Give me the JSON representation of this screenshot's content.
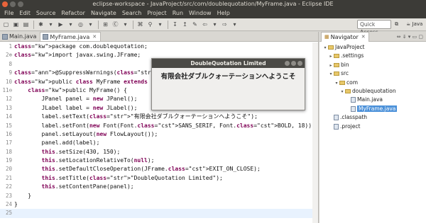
{
  "window": {
    "title": "eclipse-workspace - JavaProject/src/com/doublequotation/MyFrame.java - Eclipse IDE"
  },
  "menu": [
    "File",
    "Edit",
    "Source",
    "Refactor",
    "Navigate",
    "Search",
    "Project",
    "Run",
    "Window",
    "Help"
  ],
  "toolbar": {
    "quick_access": "Quick Access",
    "perspective_label": "Java"
  },
  "editor": {
    "tabs": [
      {
        "label": "Main.java",
        "active": false
      },
      {
        "label": "MyFrame.java",
        "active": true
      }
    ],
    "lines": [
      {
        "n": "1",
        "text": "package com.doublequotation;"
      },
      {
        "n": "2⊕",
        "text": "import javax.swing.JFrame;"
      },
      {
        "n": "8",
        "text": ""
      },
      {
        "n": "9",
        "text": "@SuppressWarnings(\"serial\")"
      },
      {
        "n": "10",
        "text": "public class MyFrame extends JFrame {"
      },
      {
        "n": "11⊖",
        "text": "    public MyFrame() {"
      },
      {
        "n": "12",
        "text": "        JPanel panel = new JPanel();"
      },
      {
        "n": "13",
        "text": "        JLabel label = new JLabel();"
      },
      {
        "n": "14",
        "text": "        label.setText(\"有限会社ダブルクォーテーションへようこそ\");"
      },
      {
        "n": "15",
        "text": "        label.setFont(new Font(Font.SANS_SERIF, Font.BOLD, 18));"
      },
      {
        "n": "16",
        "text": "        panel.setLayout(new FlowLayout());"
      },
      {
        "n": "17",
        "text": "        panel.add(label);"
      },
      {
        "n": "18",
        "text": "        this.setSize(430, 150);"
      },
      {
        "n": "19",
        "text": "        this.setLocationRelativeTo(null);"
      },
      {
        "n": "20",
        "text": "        this.setDefaultCloseOperation(JFrame.EXIT_ON_CLOSE);"
      },
      {
        "n": "21",
        "text": "        this.setTitle(\"DoubleQuotation Limited\");"
      },
      {
        "n": "22",
        "text": "        this.setContentPane(panel);"
      },
      {
        "n": "23",
        "text": "    }"
      },
      {
        "n": "24",
        "text": "}"
      },
      {
        "n": "25",
        "text": ""
      }
    ]
  },
  "navigator": {
    "tab_label": "Navigator",
    "tree": [
      {
        "label": "JavaProject",
        "depth": 0,
        "arrow": "▾",
        "kind": "folder"
      },
      {
        "label": ".settings",
        "depth": 1,
        "arrow": "▸",
        "kind": "folder"
      },
      {
        "label": "bin",
        "depth": 1,
        "arrow": "▸",
        "kind": "folder"
      },
      {
        "label": "src",
        "depth": 1,
        "arrow": "▾",
        "kind": "folder"
      },
      {
        "label": "com",
        "depth": 2,
        "arrow": "▾",
        "kind": "folder"
      },
      {
        "label": "doublequotation",
        "depth": 3,
        "arrow": "▾",
        "kind": "folder"
      },
      {
        "label": "Main.java",
        "depth": 4,
        "arrow": "",
        "kind": "java"
      },
      {
        "label": "MyFrame.java",
        "depth": 4,
        "arrow": "",
        "kind": "java",
        "selected": true
      },
      {
        "label": ".classpath",
        "depth": 1,
        "arrow": "",
        "kind": "file"
      },
      {
        "label": ".project",
        "depth": 1,
        "arrow": "",
        "kind": "file"
      }
    ]
  },
  "popup": {
    "title": "DoubleQuotation Limited",
    "message": "有限会社ダブルクォーテーションへようこそ"
  }
}
